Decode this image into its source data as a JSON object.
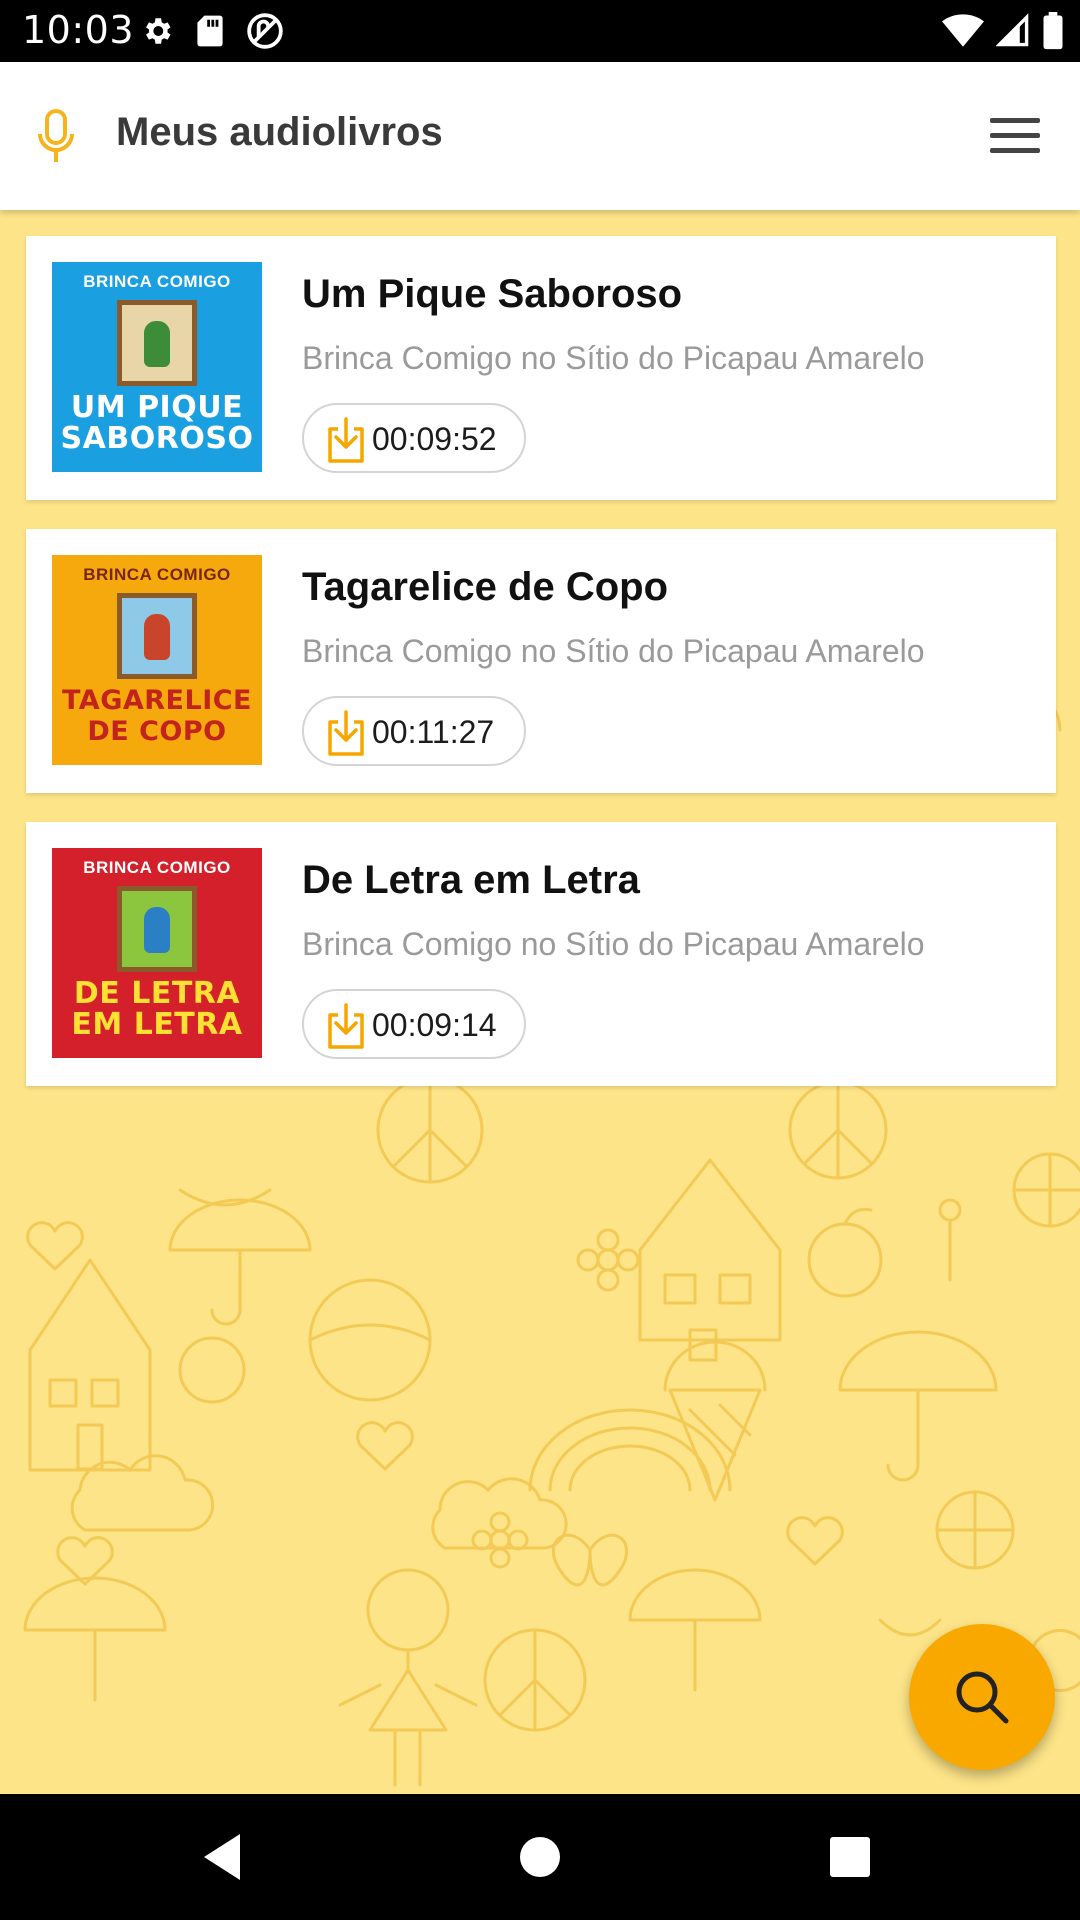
{
  "status_bar": {
    "time": "10:03",
    "left_icons": [
      "gear-icon",
      "sd-card-icon",
      "no-data-sync-icon"
    ],
    "right_icons": [
      "wifi-icon",
      "signal-icon",
      "battery-icon"
    ]
  },
  "app_bar": {
    "title": "Meus audiolivros",
    "accent_color": "#f5b41c",
    "menu_icon": "hamburger-menu-icon"
  },
  "books": [
    {
      "title": "Um Pique Saboroso",
      "subtitle": "Brinca Comigo no Sítio do Picapau Amarelo",
      "duration": "00:09:52",
      "cover": {
        "series": "BRINCA COMIGO",
        "title_lines": [
          "UM PIQUE",
          "SABOROSO"
        ],
        "bg": "#1aa0e0",
        "text_color": "#ffffff"
      }
    },
    {
      "title": "Tagarelice de Copo",
      "subtitle": "Brinca Comigo no Sítio do Picapau Amarelo",
      "duration": "00:11:27",
      "cover": {
        "series": "BRINCA COMIGO",
        "title_lines": [
          "TAGARELICE",
          "DE COPO"
        ],
        "bg": "#f5a90c",
        "text_color": "#c2231d"
      }
    },
    {
      "title": "De Letra em Letra",
      "subtitle": "Brinca Comigo no Sítio do Picapau Amarelo",
      "duration": "00:09:14",
      "cover": {
        "series": "BRINCA COMIGO",
        "title_lines": [
          "DE LETRA",
          "EM LETRA"
        ],
        "bg": "#d4202a",
        "text_color": "#ffe033"
      }
    }
  ],
  "fab": {
    "icon": "search-icon",
    "color": "#f9a800"
  },
  "nav_bar": {
    "buttons": [
      "back-icon",
      "home-icon",
      "recents-icon"
    ]
  }
}
